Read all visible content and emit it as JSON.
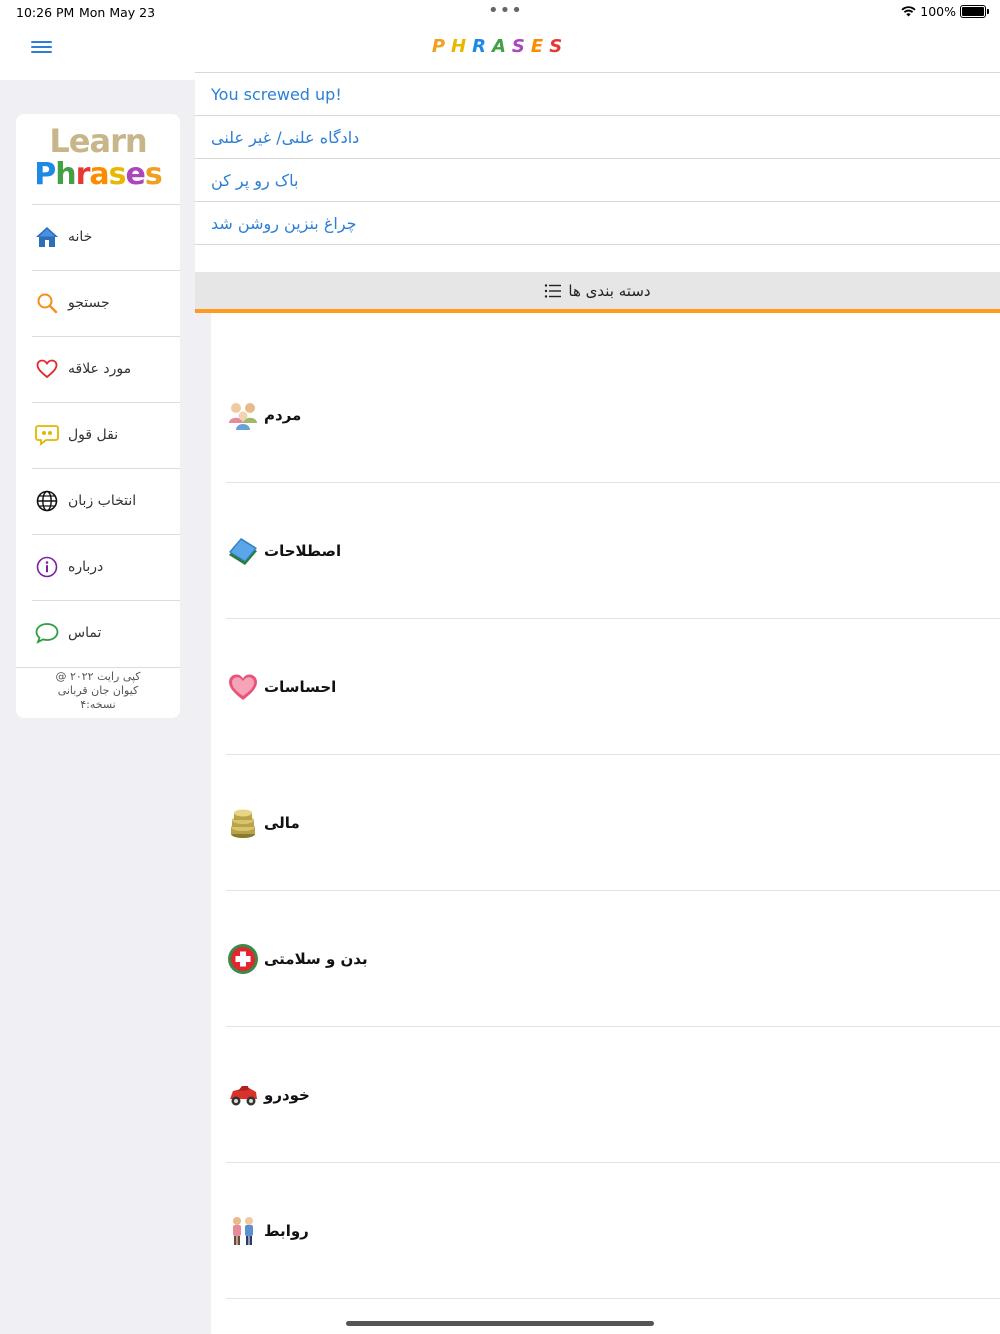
{
  "status_bar": {
    "time": "10:26 PM",
    "date": "Mon May 23",
    "battery": "100%"
  },
  "nav": {
    "title_letters": [
      {
        "ch": "P",
        "color": "#f0a020"
      },
      {
        "ch": "H",
        "color": "#e6b800"
      },
      {
        "ch": "R",
        "color": "#1e88e5"
      },
      {
        "ch": "A",
        "color": "#43a047"
      },
      {
        "ch": "S",
        "color": "#ab47bc"
      },
      {
        "ch": "E",
        "color": "#fb8c00"
      },
      {
        "ch": "S",
        "color": "#e53935"
      }
    ]
  },
  "sidebar": {
    "logo_line1": "Learn",
    "logo_line2": [
      {
        "ch": "P",
        "color": "#1e88e5"
      },
      {
        "ch": "h",
        "color": "#43a047"
      },
      {
        "ch": "r",
        "color": "#e53935"
      },
      {
        "ch": "a",
        "color": "#fb8c00"
      },
      {
        "ch": "s",
        "color": "#e6b800"
      },
      {
        "ch": "e",
        "color": "#ab47bc"
      },
      {
        "ch": "s",
        "color": "#f0a020"
      }
    ],
    "items": [
      {
        "label": "خانه",
        "icon": "home-icon"
      },
      {
        "label": "جستجو",
        "icon": "search-icon"
      },
      {
        "label": "مورد علاقه",
        "icon": "heart-icon"
      },
      {
        "label": "نقل قول",
        "icon": "quote-icon"
      },
      {
        "label": "انتخاب زبان",
        "icon": "globe-icon"
      },
      {
        "label": "درباره",
        "icon": "info-icon"
      },
      {
        "label": "تماس",
        "icon": "chat-icon"
      }
    ],
    "copyright_lines": [
      "کپی رایت ۲۰۲۲ @",
      "کیوان جان قربانی",
      "نسخه:۴"
    ]
  },
  "phrases": [
    "You screwed up!",
    "دادگاه علنی/ غیر علنی",
    "باک رو پر کن",
    "چراغ بنزین روشن شد"
  ],
  "categories_header": "دسته بندی ها",
  "categories": [
    {
      "label": "مردم",
      "icon": "people-icon"
    },
    {
      "label": "اصطلاحات",
      "icon": "books-icon"
    },
    {
      "label": "احساسات",
      "icon": "heart-box-icon"
    },
    {
      "label": "مالی",
      "icon": "coins-icon"
    },
    {
      "label": "بدن و سلامتی",
      "icon": "health-cross-icon"
    },
    {
      "label": "خودرو",
      "icon": "car-icon"
    },
    {
      "label": "روابط",
      "icon": "couple-icon"
    }
  ]
}
